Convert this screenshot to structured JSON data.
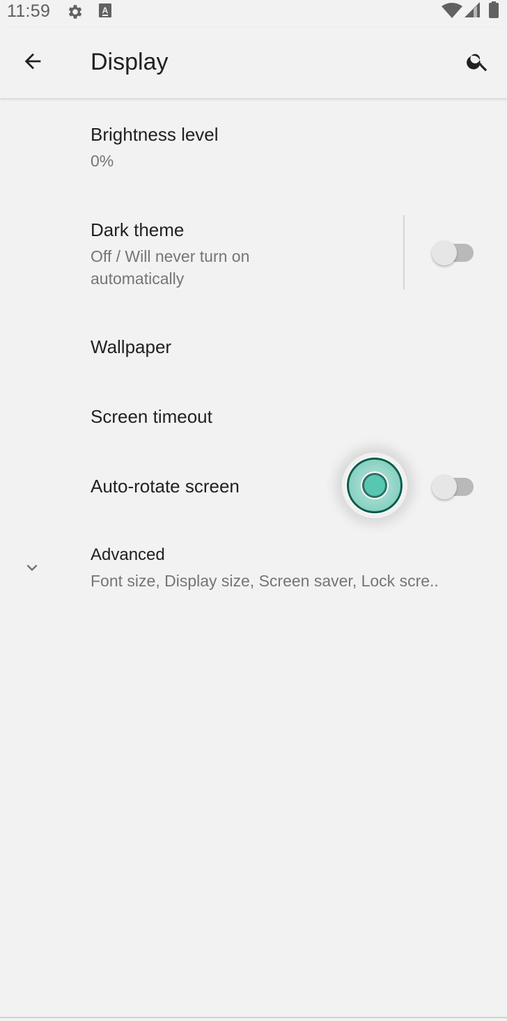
{
  "status_bar": {
    "time": "11:59",
    "icons_left": [
      "settings-gear-icon",
      "font-a-icon"
    ],
    "icons_right": [
      "wifi-icon",
      "cellular-signal-icon",
      "battery-icon"
    ]
  },
  "app_bar": {
    "back_icon": "arrow-back-icon",
    "title": "Display",
    "search_icon": "search-icon"
  },
  "items": [
    {
      "title": "Brightness level",
      "subtitle": "0%"
    },
    {
      "title": "Dark theme",
      "subtitle_line1": "Off / Will never turn on",
      "subtitle_line2": "automatically",
      "toggle": "off"
    },
    {
      "title": "Wallpaper"
    },
    {
      "title": "Screen timeout"
    },
    {
      "title": "Auto-rotate screen",
      "toggle": "off"
    },
    {
      "title": "Advanced",
      "subtitle": "Font size, Display size, Screen saver, Lock scre..",
      "icon": "chevron-down-icon"
    }
  ],
  "colors": {
    "background": "#f2f2f2",
    "primary_text": "#212121",
    "secondary_text": "#757575",
    "touch_accent": "#58c7b1"
  }
}
